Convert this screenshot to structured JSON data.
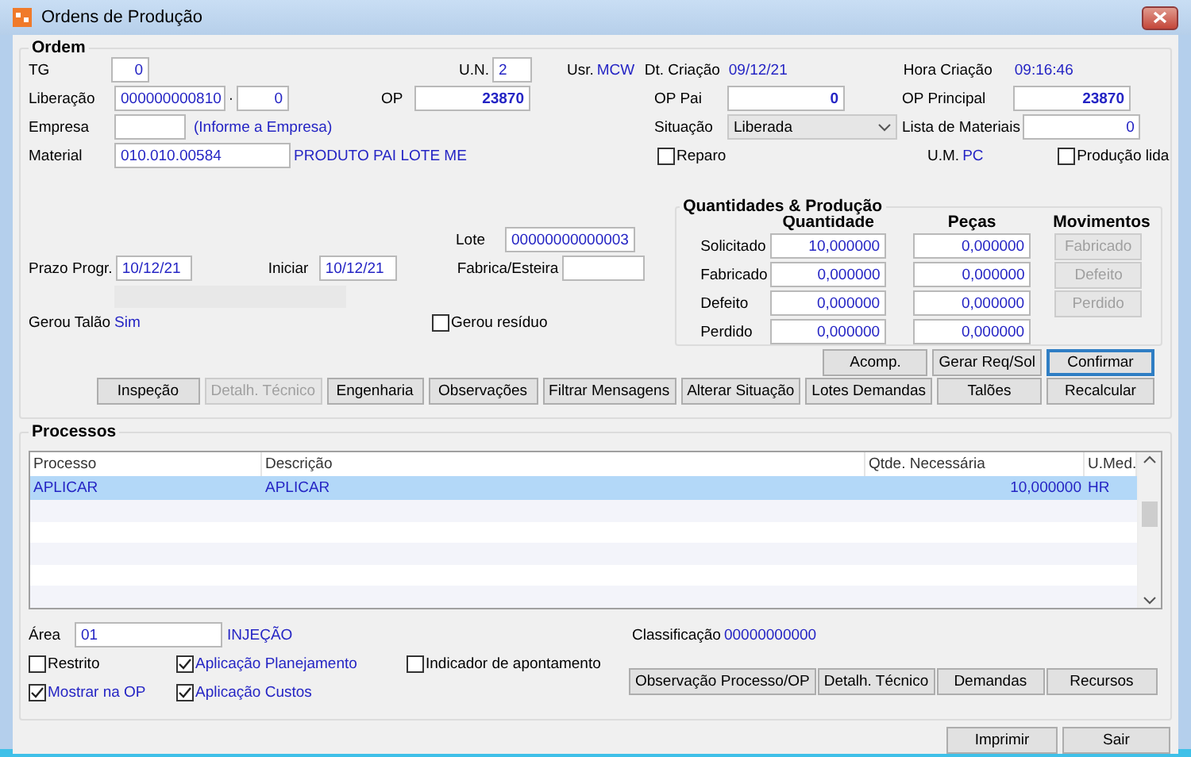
{
  "window": {
    "title": "Ordens de Produção"
  },
  "ordem": {
    "title": "Ordem",
    "tg": {
      "label": "TG",
      "value": "0"
    },
    "un": {
      "label": "U.N.",
      "value": "2"
    },
    "usr": {
      "label": "Usr.",
      "value": "MCW"
    },
    "dt_criacao": {
      "label": "Dt. Criação",
      "value": "09/12/21"
    },
    "hora_criacao": {
      "label": "Hora Criação",
      "value": "09:16:46"
    },
    "liberacao": {
      "label": "Liberação",
      "value": "000000000810",
      "separator": "·",
      "sequence": "0"
    },
    "op": {
      "label": "OP",
      "value": "23870"
    },
    "op_pai": {
      "label": "OP Pai",
      "value": "0"
    },
    "op_principal": {
      "label": "OP Principal",
      "value": "23870"
    },
    "empresa": {
      "label": "Empresa",
      "hint": "(Informe a Empresa)"
    },
    "situacao": {
      "label": "Situação",
      "value": "Liberada"
    },
    "lista_materiais": {
      "label": "Lista de Materiais",
      "value": "0"
    },
    "material": {
      "label": "Material",
      "value": "010.010.00584",
      "description": "PRODUTO PAI LOTE ME"
    },
    "reparo": {
      "label": "Reparo",
      "checked": false
    },
    "um": {
      "label": "U.M.",
      "value": "PC"
    },
    "producao_lida": {
      "label": "Produção lida",
      "checked": false
    },
    "lote": {
      "label": "Lote",
      "value": "00000000000003"
    },
    "prazo_progr": {
      "label": "Prazo Progr.",
      "value": "10/12/21"
    },
    "iniciar": {
      "label": "Iniciar",
      "value": "10/12/21"
    },
    "fabrica_esteira": {
      "label": "Fabrica/Esteira"
    },
    "gerou_talao": {
      "label": "Gerou Talão",
      "value": "Sim"
    },
    "gerou_residuo": {
      "label": "Gerou resíduo",
      "checked": false
    }
  },
  "quantidades": {
    "title": "Quantidades & Produção",
    "columns": [
      "Quantidade",
      "Peças",
      "Movimentos"
    ],
    "rows": [
      {
        "label": "Solicitado",
        "quantidade": "10,000000",
        "pecas": "0,000000",
        "action": {
          "label": "Fabricado",
          "disabled": true
        }
      },
      {
        "label": "Fabricado",
        "quantidade": "0,000000",
        "pecas": "0,000000",
        "action": {
          "label": "Defeito",
          "disabled": true
        }
      },
      {
        "label": "Defeito",
        "quantidade": "0,000000",
        "pecas": "0,000000",
        "action": {
          "label": "Perdido",
          "disabled": true
        }
      },
      {
        "label": "Perdido",
        "quantidade": "0,000000",
        "pecas": "0,000000"
      }
    ]
  },
  "action_buttons_top": [
    {
      "label": "Acomp.",
      "disabled": false,
      "default": false
    },
    {
      "label": "Gerar Req/Sol",
      "disabled": false,
      "default": false
    },
    {
      "label": "Confirmar",
      "disabled": false,
      "default": true
    }
  ],
  "action_buttons": [
    {
      "label": "Inspeção",
      "disabled": false
    },
    {
      "label": "Detalh. Técnico",
      "disabled": true
    },
    {
      "label": "Engenharia",
      "disabled": false
    },
    {
      "label": "Observações",
      "disabled": false
    },
    {
      "label": "Filtrar Mensagens",
      "disabled": false
    },
    {
      "label": "Alterar Situação",
      "disabled": false
    },
    {
      "label": "Lotes Demandas",
      "disabled": false
    },
    {
      "label": "Talões",
      "disabled": false
    },
    {
      "label": "Recalcular",
      "disabled": false
    }
  ],
  "processos": {
    "title": "Processos",
    "table": {
      "columns": [
        "Processo",
        "Descrição",
        "Qtde. Necessária",
        "U.Med."
      ],
      "rows": [
        {
          "processo": "APLICAR",
          "descricao": "APLICAR",
          "qtde": "10,000000",
          "umed": "HR",
          "selected": true
        }
      ]
    },
    "area": {
      "label": "Área",
      "value": "01",
      "description": "INJEÇÃO"
    },
    "classificacao": {
      "label": "Classificação",
      "value": "00000000000"
    },
    "options": [
      {
        "label": "Restrito",
        "checked": false
      },
      {
        "label": "Aplicação Planejamento",
        "checked": true
      },
      {
        "label": "Indicador de apontamento",
        "checked": false
      },
      {
        "label": "Mostrar na OP",
        "checked": true
      },
      {
        "label": "Aplicação Custos",
        "checked": true
      }
    ],
    "buttons": [
      {
        "label": "Observação Processo/OP",
        "disabled": false
      },
      {
        "label": "Detalh. Técnico",
        "disabled": false
      },
      {
        "label": "Demandas",
        "disabled": false
      },
      {
        "label": "Recursos",
        "disabled": false
      }
    ]
  },
  "footer_buttons": [
    {
      "label": "Imprimir",
      "disabled": false
    },
    {
      "label": "Sair",
      "disabled": false
    }
  ]
}
